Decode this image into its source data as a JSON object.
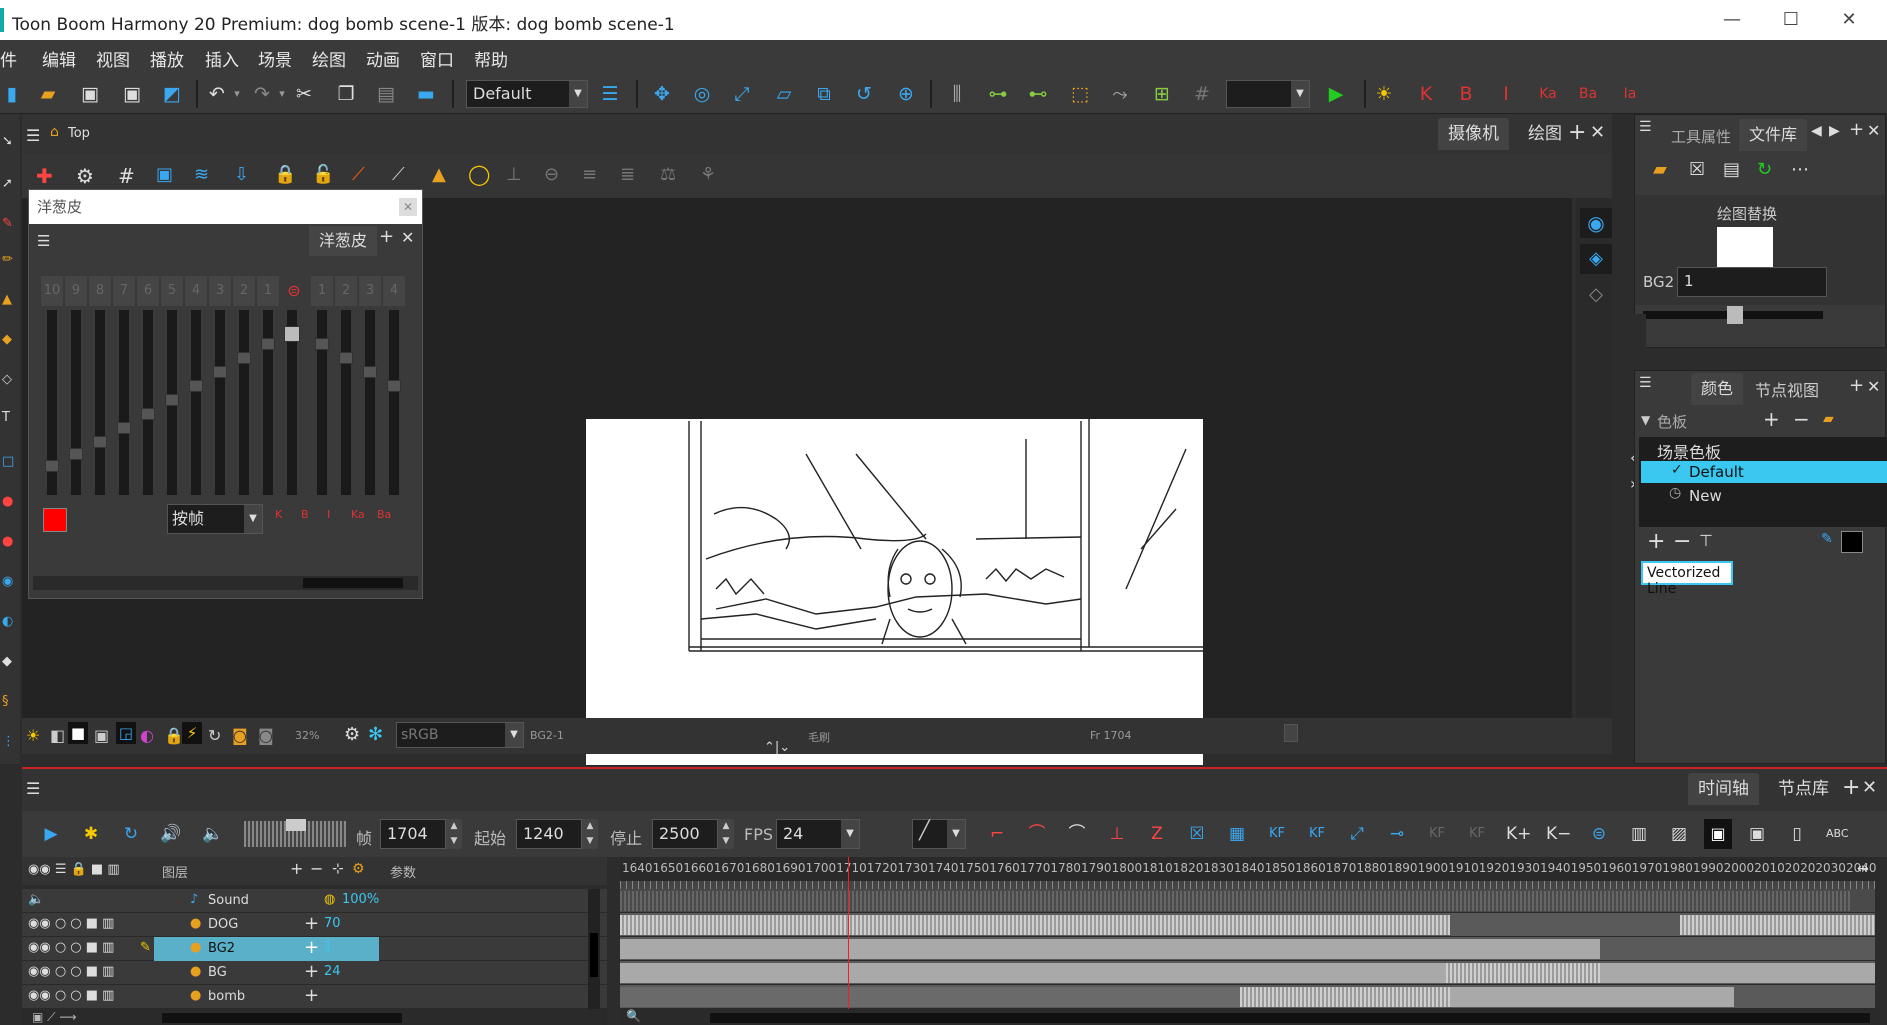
{
  "window": {
    "title": "Toon Boom Harmony 20 Premium: dog bomb scene-1 版本: dog bomb scene-1",
    "minimize": "—",
    "maximize": "☐",
    "close": "✕"
  },
  "menu": [
    "件",
    "编辑",
    "视图",
    "播放",
    "插入",
    "场景",
    "绘图",
    "动画",
    "窗口",
    "帮助"
  ],
  "toolbar": {
    "workspace": "Default"
  },
  "camera": {
    "breadcrumb": "Top",
    "tabs": [
      "摄像机",
      "绘图"
    ],
    "zoom": "32%",
    "colorspace": "sRGB",
    "drawing_name": "BG2-1",
    "mode": "毛刷",
    "frame": "Fr 1704"
  },
  "onion": {
    "title": "洋葱皮",
    "tab": "洋葱皮",
    "numbers_before": [
      "10",
      "9",
      "8",
      "7",
      "6",
      "5",
      "4",
      "3",
      "2",
      "1"
    ],
    "numbers_after": [
      "1",
      "2",
      "3",
      "4"
    ],
    "mode": "按帧",
    "mode_buttons": [
      "K",
      "B",
      "I",
      "Ka",
      "Ba"
    ]
  },
  "right": {
    "tabs_top": [
      "工具属性",
      "文件库"
    ],
    "drawing_sub": "绘图替换",
    "drawing_layer": "BG2",
    "drawing_value": "1",
    "tabs_mid": [
      "颜色",
      "节点视图"
    ],
    "palette_label": "色板",
    "scene_palette": "场景色板",
    "palettes": [
      "Default",
      "New"
    ],
    "swatch_name": "Vectorized Line"
  },
  "timeline": {
    "tabs": [
      "时间轴",
      "节点库"
    ],
    "frame_label": "帧",
    "frame": "1704",
    "start_label": "起始",
    "start": "1240",
    "stop_label": "停止",
    "stop": "2500",
    "fps_label": "FPS",
    "fps": "24",
    "layers_header": "图层",
    "params_header": "参数",
    "ruler": [
      "1640",
      "1650",
      "1660",
      "1670",
      "1680",
      "1690",
      "1700",
      "1710",
      "1720",
      "1730",
      "1740",
      "1750",
      "1760",
      "1770",
      "1780",
      "1790",
      "1800",
      "1810",
      "1820",
      "1830",
      "1840",
      "1850",
      "1860",
      "1870",
      "1880",
      "1890",
      "1900",
      "1910",
      "1920",
      "1930",
      "1940",
      "1950",
      "1960",
      "1970",
      "1980",
      "1990",
      "2000",
      "2010",
      "2020",
      "2030",
      "2040"
    ],
    "layers": [
      {
        "name": "Sound",
        "param": "100%"
      },
      {
        "name": "DOG",
        "param": "70"
      },
      {
        "name": "BG2",
        "param": "1"
      },
      {
        "name": "BG",
        "param": "24"
      },
      {
        "name": "bomb",
        "param": ""
      }
    ]
  },
  "colors": {
    "accent": "#3ac8f0",
    "selection": "#5ab0c8",
    "timeline_border": "#cc2222",
    "onion_color": "#ff0000"
  }
}
